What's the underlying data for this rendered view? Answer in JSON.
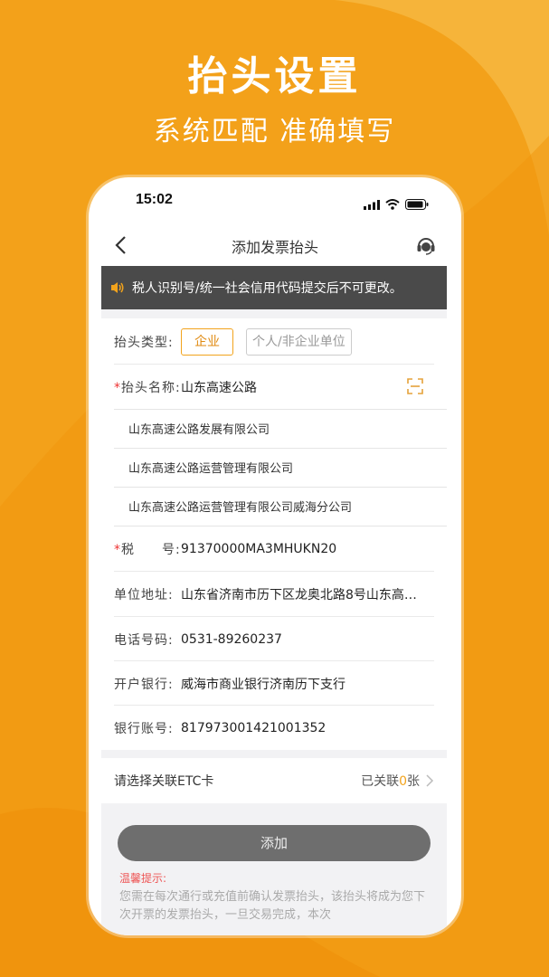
{
  "promo": {
    "title": "抬头设置",
    "subtitle": "系统匹配 准确填写"
  },
  "status_bar": {
    "time": "15:02"
  },
  "nav": {
    "title": "添加发票抬头"
  },
  "notice": {
    "text": "税人识别号/统一社会信用代码提交后不可更改。"
  },
  "form": {
    "type_label": "抬头类型:",
    "type_options": [
      "企业",
      "个人/非企业单位"
    ],
    "type_selected": "企业",
    "name_required": "*",
    "name_label": "抬头名称:",
    "name_value": "山东高速公路",
    "suggestions": [
      "山东高速公路发展有限公司",
      "山东高速公路运营管理有限公司",
      "山东高速公路运营管理有限公司威海分公司"
    ],
    "tax_required": "*",
    "tax_label": "税　　号:",
    "tax_value": "91370000MA3MHUKN20",
    "address_label": "单位地址:",
    "address_value": "山东省济南市历下区龙奥北路8号山东高…",
    "phone_label": "电话号码:",
    "phone_value": "0531-89260237",
    "bank_label": "开户银行:",
    "bank_value": "威海市商业银行济南历下支行",
    "account_label": "银行账号:",
    "account_value": "817973001421001352"
  },
  "etc": {
    "label": "请选择关联ETC卡",
    "linked_prefix": "已关联",
    "linked_count": "0",
    "linked_suffix": "张"
  },
  "actions": {
    "add_label": "添加"
  },
  "tips": {
    "title": "温馨提示:",
    "text": "您需在每次通行或充值前确认发票抬头，该抬头将成为您下次开票的发票抬头，一旦交易完成，本次"
  },
  "colors": {
    "brand_orange": "#f2a31c",
    "notice_bg": "#4a4a4a",
    "button_gray": "#6e6e6e",
    "required_red": "#e33"
  }
}
